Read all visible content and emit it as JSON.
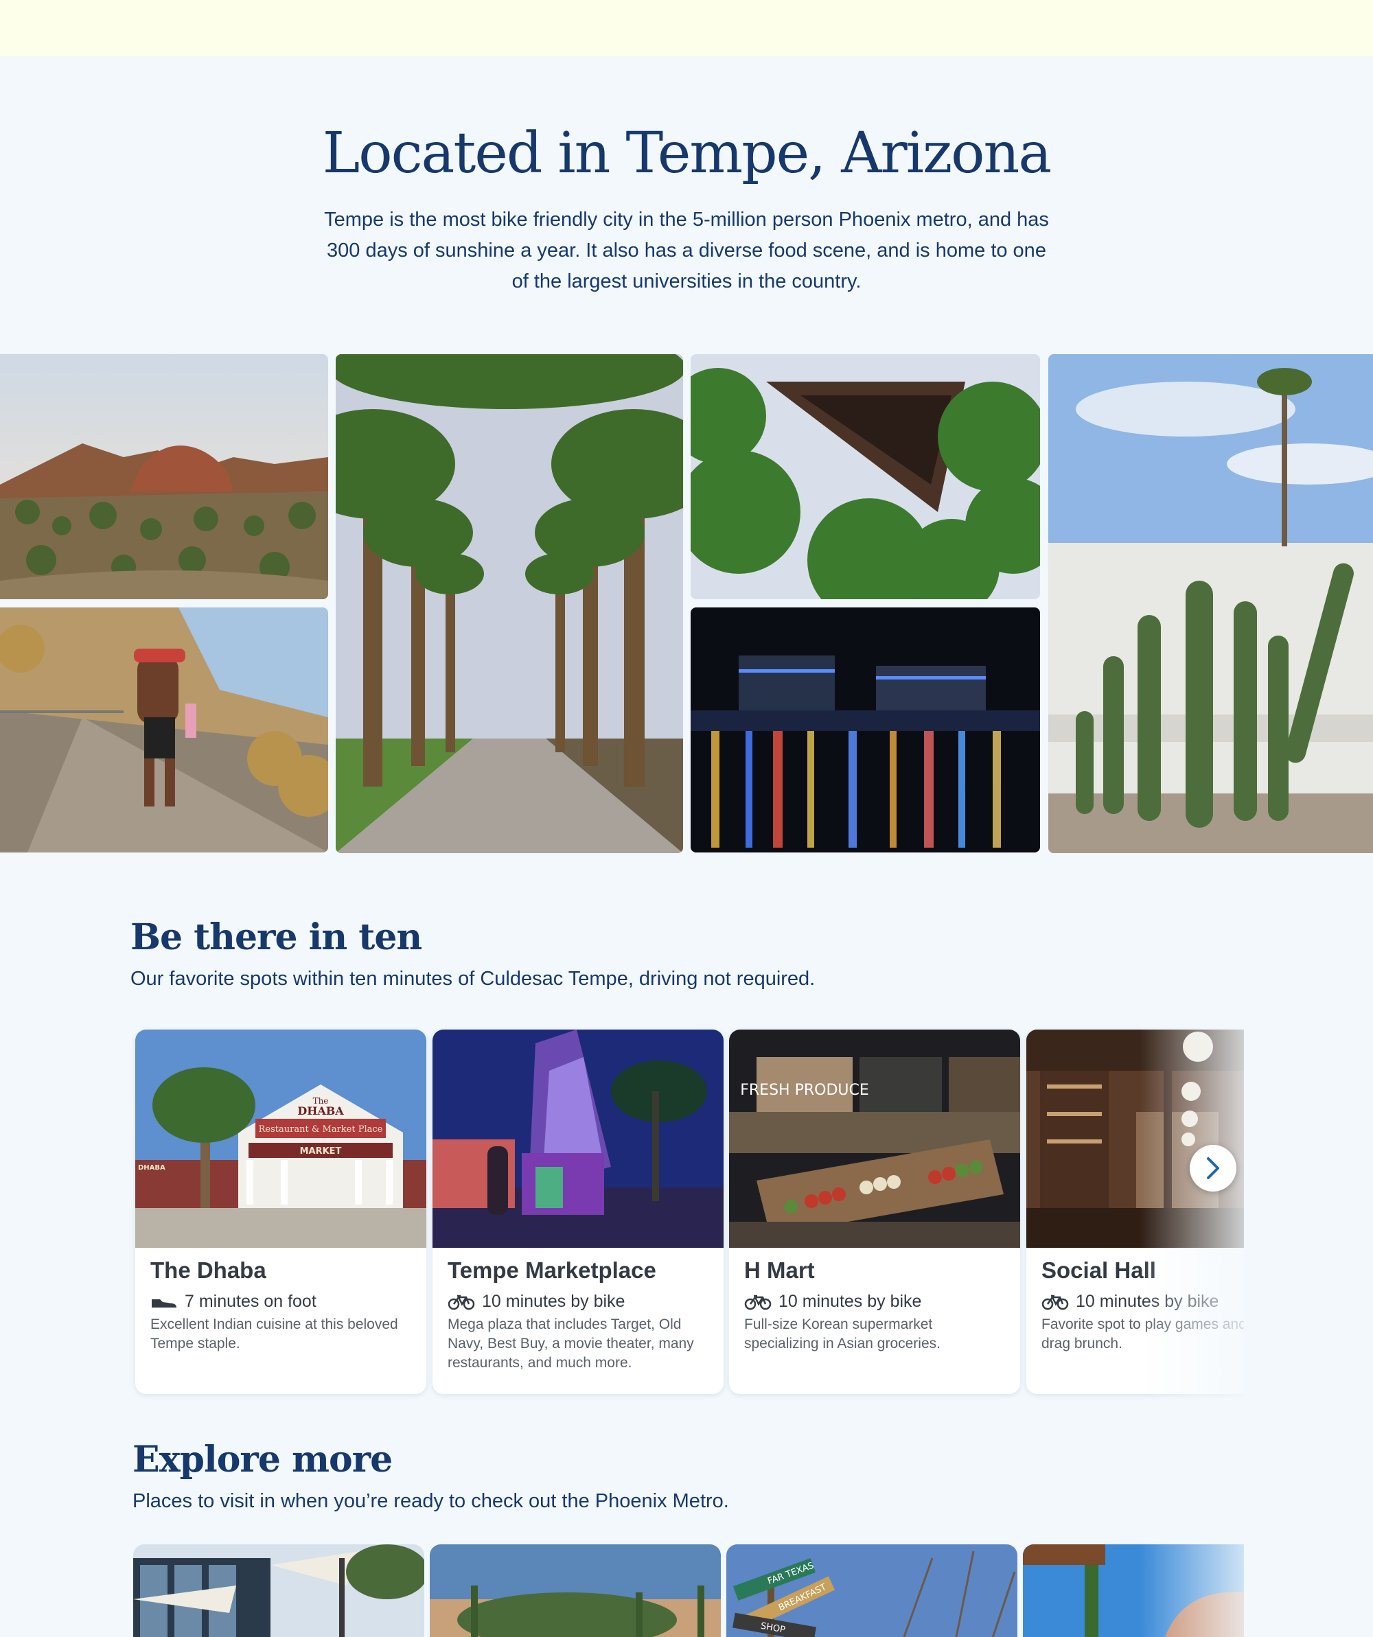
{
  "hero": {
    "title": "Located in Tempe, Arizona",
    "description": "Tempe is the most bike friendly city in the 5-million person Phoenix metro, and has 300 days of sunshine a year. It also has a diverse food scene, and is home to one of the largest universities in the country."
  },
  "gallery": {
    "photos": [
      {
        "subject": "desert-mountains"
      },
      {
        "subject": "hiker-on-trail"
      },
      {
        "subject": "palm-walk"
      },
      {
        "subject": "angular-building"
      },
      {
        "subject": "tempe-town-lake-night"
      },
      {
        "subject": "saguaro-cactus"
      }
    ]
  },
  "nearby": {
    "title": "Be there in ten",
    "subtitle": "Our favorite spots within ten minutes of Culdesac Tempe, driving not required.",
    "cards": [
      {
        "name": "The Dhaba",
        "travel": "7 minutes on foot",
        "mode_icon": "shoe-icon",
        "description": "Excellent Indian cuisine at this beloved Tempe staple.",
        "sign_line1": "The",
        "sign_line2": "DHABA",
        "sign_line3": "Restaurant & Market Place",
        "sign_line4": "MARKET",
        "sign_side": "DHABA"
      },
      {
        "name": "Tempe Marketplace",
        "travel": "10 minutes by bike",
        "mode_icon": "bike-icon",
        "description": "Mega plaza that includes Target, Old Navy, Best Buy, a movie theater, many restaurants, and much more."
      },
      {
        "name": "H Mart",
        "travel": "10 minutes by bike",
        "mode_icon": "bike-icon",
        "description": "Full-size Korean supermarket specializing in Asian groceries.",
        "sign": "FRESH PRODUCE"
      },
      {
        "name": "Social Hall",
        "travel": "10 minutes by bike",
        "mode_icon": "bike-icon",
        "description": "Favorite spot to play games and catch drag brunch."
      }
    ],
    "next_icon": "chevron-right-icon"
  },
  "explore": {
    "title": "Explore more",
    "subtitle": "Places to visit in when you’re ready to check out the Phoenix Metro.",
    "cards": [
      {
        "subject": "modern-building"
      },
      {
        "subject": "desert-sunset"
      },
      {
        "subject": "signpost",
        "sign1": "FAR TEXAS",
        "sign2": "BREAKFAST",
        "sign3": "SHOP"
      },
      {
        "subject": "red-rock-sculpture"
      }
    ]
  },
  "colors": {
    "background": "#f2f8fc",
    "top_band": "#fdffea",
    "heading": "#17386b",
    "card_text": "#333a44",
    "accent": "#1e66b4"
  }
}
